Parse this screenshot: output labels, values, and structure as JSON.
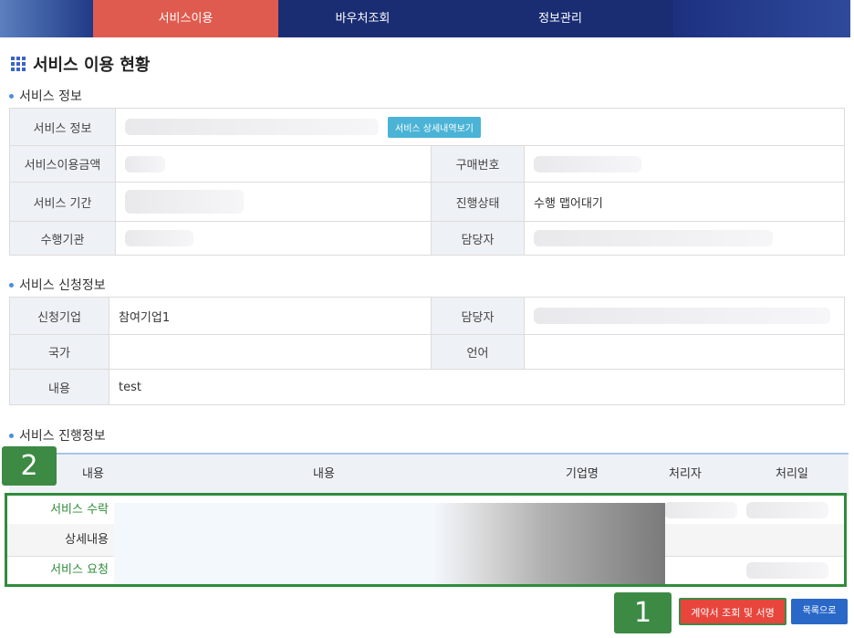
{
  "nav": {
    "tabs": [
      {
        "label": "서비스이용"
      },
      {
        "label": "바우처조회"
      },
      {
        "label": "정보관리"
      }
    ]
  },
  "page_title": "서비스 이용 현황",
  "service_info": {
    "section_title": "서비스 정보",
    "labels": {
      "service_info": "서비스 정보",
      "amount": "서비스이용금액",
      "purchase_no": "구매번호",
      "period": "서비스 기간",
      "status": "진행상태",
      "agency": "수행기관",
      "manager": "담당자"
    },
    "detail_button": "서비스 상세내역보기",
    "status_value": "수행 맵어대기"
  },
  "application_info": {
    "section_title": "서비스 신청정보",
    "labels": {
      "company": "신청기업",
      "manager": "담당자",
      "country": "국가",
      "language": "언어",
      "content": "내용"
    },
    "company_value": "참여기업1",
    "content_value": "test"
  },
  "progress_info": {
    "section_title": "서비스 진행정보",
    "columns": [
      "내용",
      "내용",
      "기업명",
      "처리자",
      "처리일"
    ],
    "rows": [
      {
        "label": "서비스 수락"
      },
      {
        "label": "상세내용"
      },
      {
        "label": "서비스 요청"
      }
    ]
  },
  "badges": {
    "one": "1",
    "two": "2"
  },
  "buttons": {
    "contract": "계약서 조회 및 서명",
    "list": "목록으로"
  }
}
